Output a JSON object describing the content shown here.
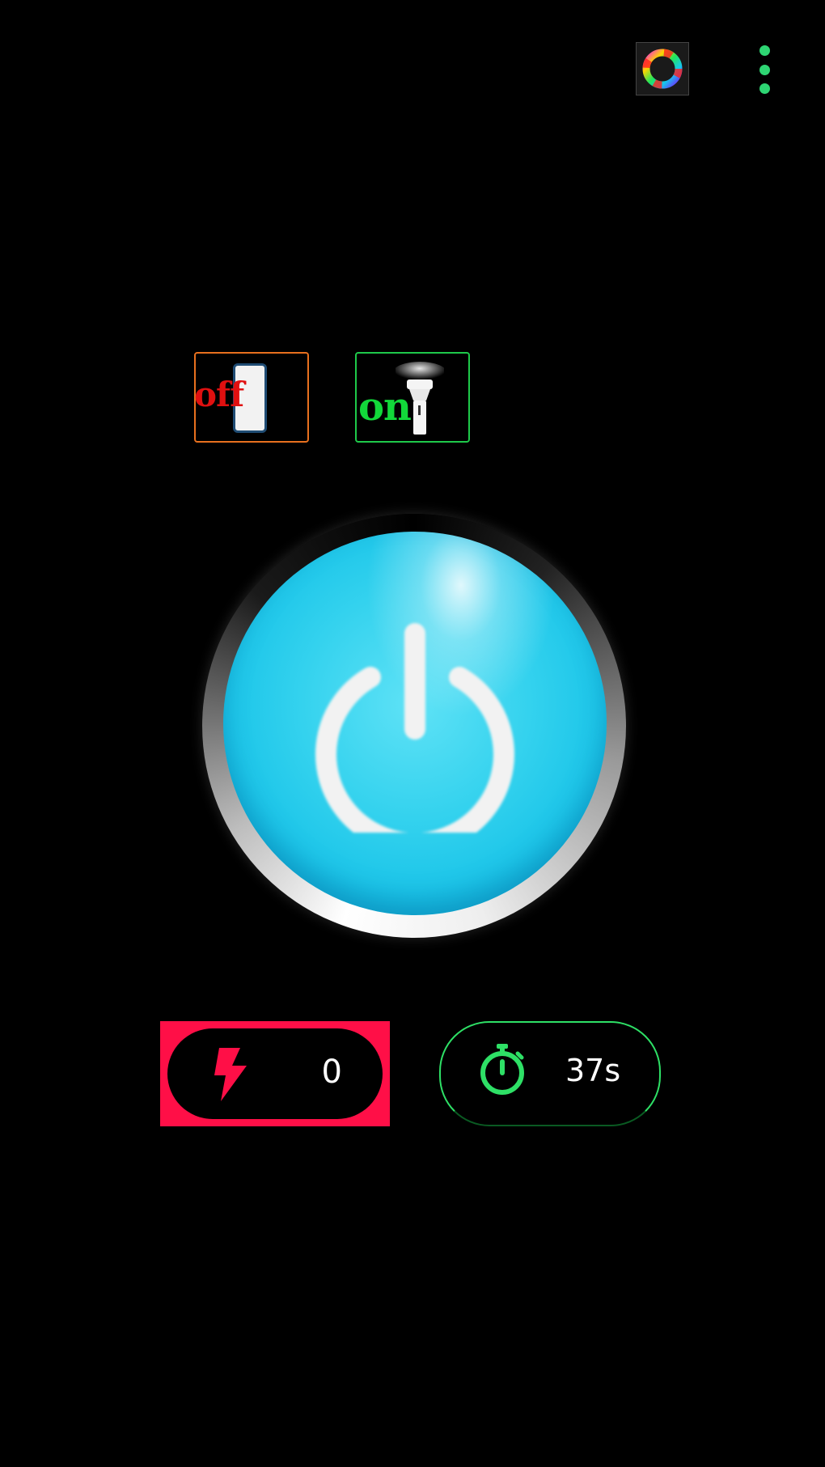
{
  "top_bar": {
    "color_picker_icon": "color-wheel-icon",
    "menu_icon": "overflow-menu-icon"
  },
  "modes": {
    "screen_light": {
      "label": "off",
      "icon": "phone-icon",
      "border_color": "#e8701e",
      "label_color": "#e01010"
    },
    "flashlight": {
      "label": "on",
      "icon": "flashlight-icon",
      "border_color": "#1ec94a",
      "label_color": "#12d83a"
    }
  },
  "power": {
    "icon": "power-icon",
    "color": "#18c3e8"
  },
  "stats": {
    "flash_count": {
      "icon": "lightning-bolt-icon",
      "value": "0",
      "accent": "#ff0f47"
    },
    "timer": {
      "icon": "stopwatch-icon",
      "value": "37s",
      "accent": "#2ee066"
    }
  }
}
